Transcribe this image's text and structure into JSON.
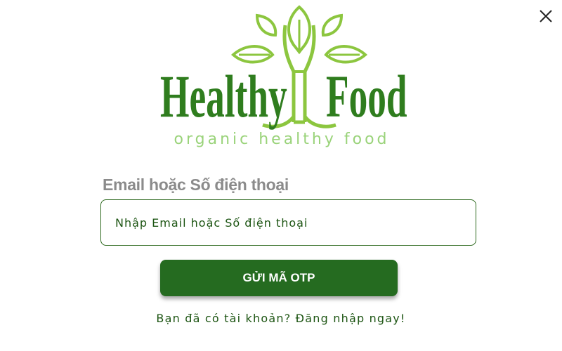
{
  "logo": {
    "word_left": "Healthy",
    "word_right": "Food",
    "tagline": "organic healthy food"
  },
  "form": {
    "label": "Email hoặc Số điện thoại",
    "input_placeholder": "Nhập Email hoặc Số điện thoại",
    "input_value": "",
    "submit_label": "GỬI MÃ OTP",
    "login_link": "Bạn đã có tài khoản? Đăng nhập ngay!"
  },
  "icons": {
    "close": "close-icon",
    "logo": "tree-leaf-logo-icon"
  },
  "colors": {
    "brand_dark_green": "#256b20",
    "logo_green": "#2f7d1e",
    "leaf_light_green": "#8cc63f",
    "label_gray": "#8b8b8b",
    "text_green": "#1d5513"
  }
}
